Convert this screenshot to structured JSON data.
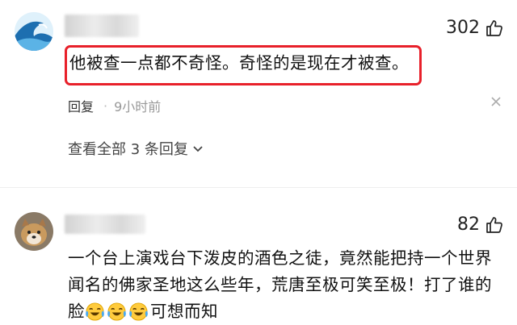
{
  "comments": [
    {
      "likes": "302",
      "text": "他被查一点都不奇怪。奇怪的是现在才被查。",
      "reply_label": "回复",
      "time": "9小时前",
      "view_replies": "查看全部 3 条回复"
    },
    {
      "likes": "82",
      "text_line1": "一个台上演戏台下泼皮的酒色之徒，竟然能把持一个世界",
      "text_line2": "闻名的佛家圣地这么些年，荒唐至极可笑至极！打了谁的",
      "text_line3_prefix": "脸",
      "text_line3_suffix": "可想而知",
      "emoji": "laughing-crying-emoji"
    }
  ],
  "colors": {
    "highlight": "#e8202a",
    "muted": "#999999"
  },
  "icons": {
    "like": "thumbs-up-icon",
    "close": "close-icon",
    "expand": "chevron-down-icon"
  }
}
